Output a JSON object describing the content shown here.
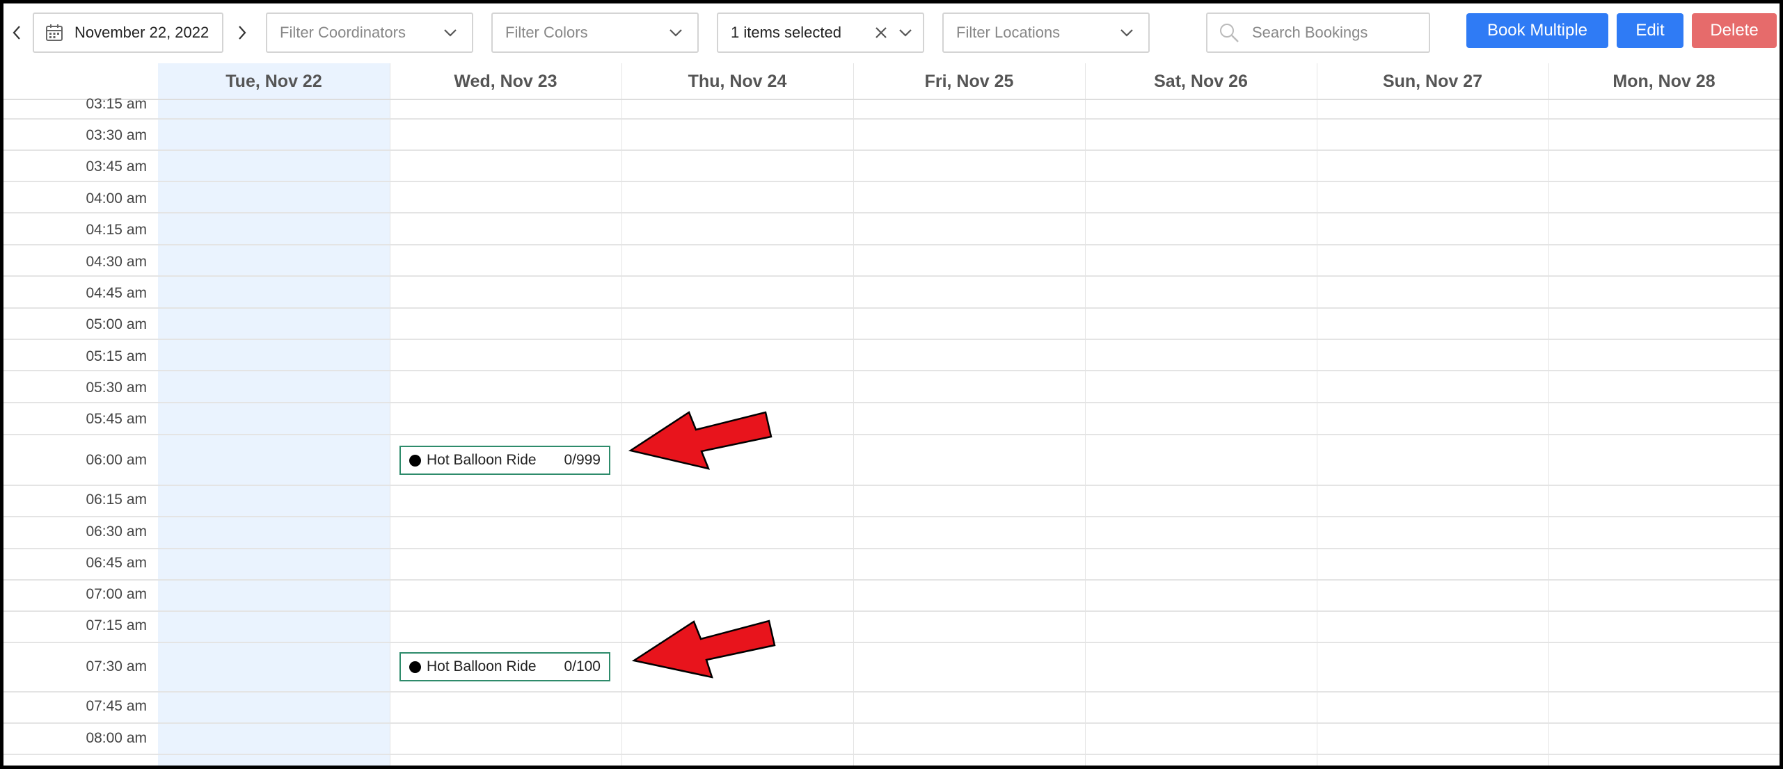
{
  "toolbar": {
    "date": "November 22, 2022",
    "filter_coordinators_placeholder": "Filter Coordinators",
    "filter_colors_placeholder": "Filter Colors",
    "selection_value": "1 items selected",
    "filter_locations_placeholder": "Filter Locations",
    "search_placeholder": "Search Bookings",
    "book_multiple_label": "Book Multiple",
    "edit_label": "Edit",
    "delete_label": "Delete"
  },
  "days": [
    "Tue, Nov 22",
    "Wed, Nov 23",
    "Thu, Nov 24",
    "Fri, Nov 25",
    "Sat, Nov 26",
    "Sun, Nov 27",
    "Mon, Nov 28"
  ],
  "times": [
    "03:15 am",
    "03:30 am",
    "03:45 am",
    "04:00 am",
    "04:15 am",
    "04:30 am",
    "04:45 am",
    "05:00 am",
    "05:15 am",
    "05:30 am",
    "05:45 am",
    "06:00 am",
    "06:15 am",
    "06:30 am",
    "06:45 am",
    "07:00 am",
    "07:15 am",
    "07:30 am",
    "07:45 am",
    "08:00 am"
  ],
  "events": [
    {
      "name": "Hot Balloon Ride",
      "count": "0/999",
      "day": "Wed, Nov 23",
      "time": "06:00 am"
    },
    {
      "name": "Hot Balloon Ride",
      "count": "0/100",
      "day": "Wed, Nov 23",
      "time": "07:30 am"
    }
  ],
  "colors": {
    "primary": "#2f7bf5",
    "danger": "#e66b6b",
    "today_bg": "#eaf3fe",
    "event_border": "#2e8b6b",
    "annotation_arrow": "#e8141c"
  },
  "icons": [
    "chevron-left-icon",
    "chevron-right-icon",
    "calendar-icon",
    "chevron-down-icon",
    "close-icon",
    "search-icon",
    "dot-icon",
    "red-arrow-annotation"
  ]
}
